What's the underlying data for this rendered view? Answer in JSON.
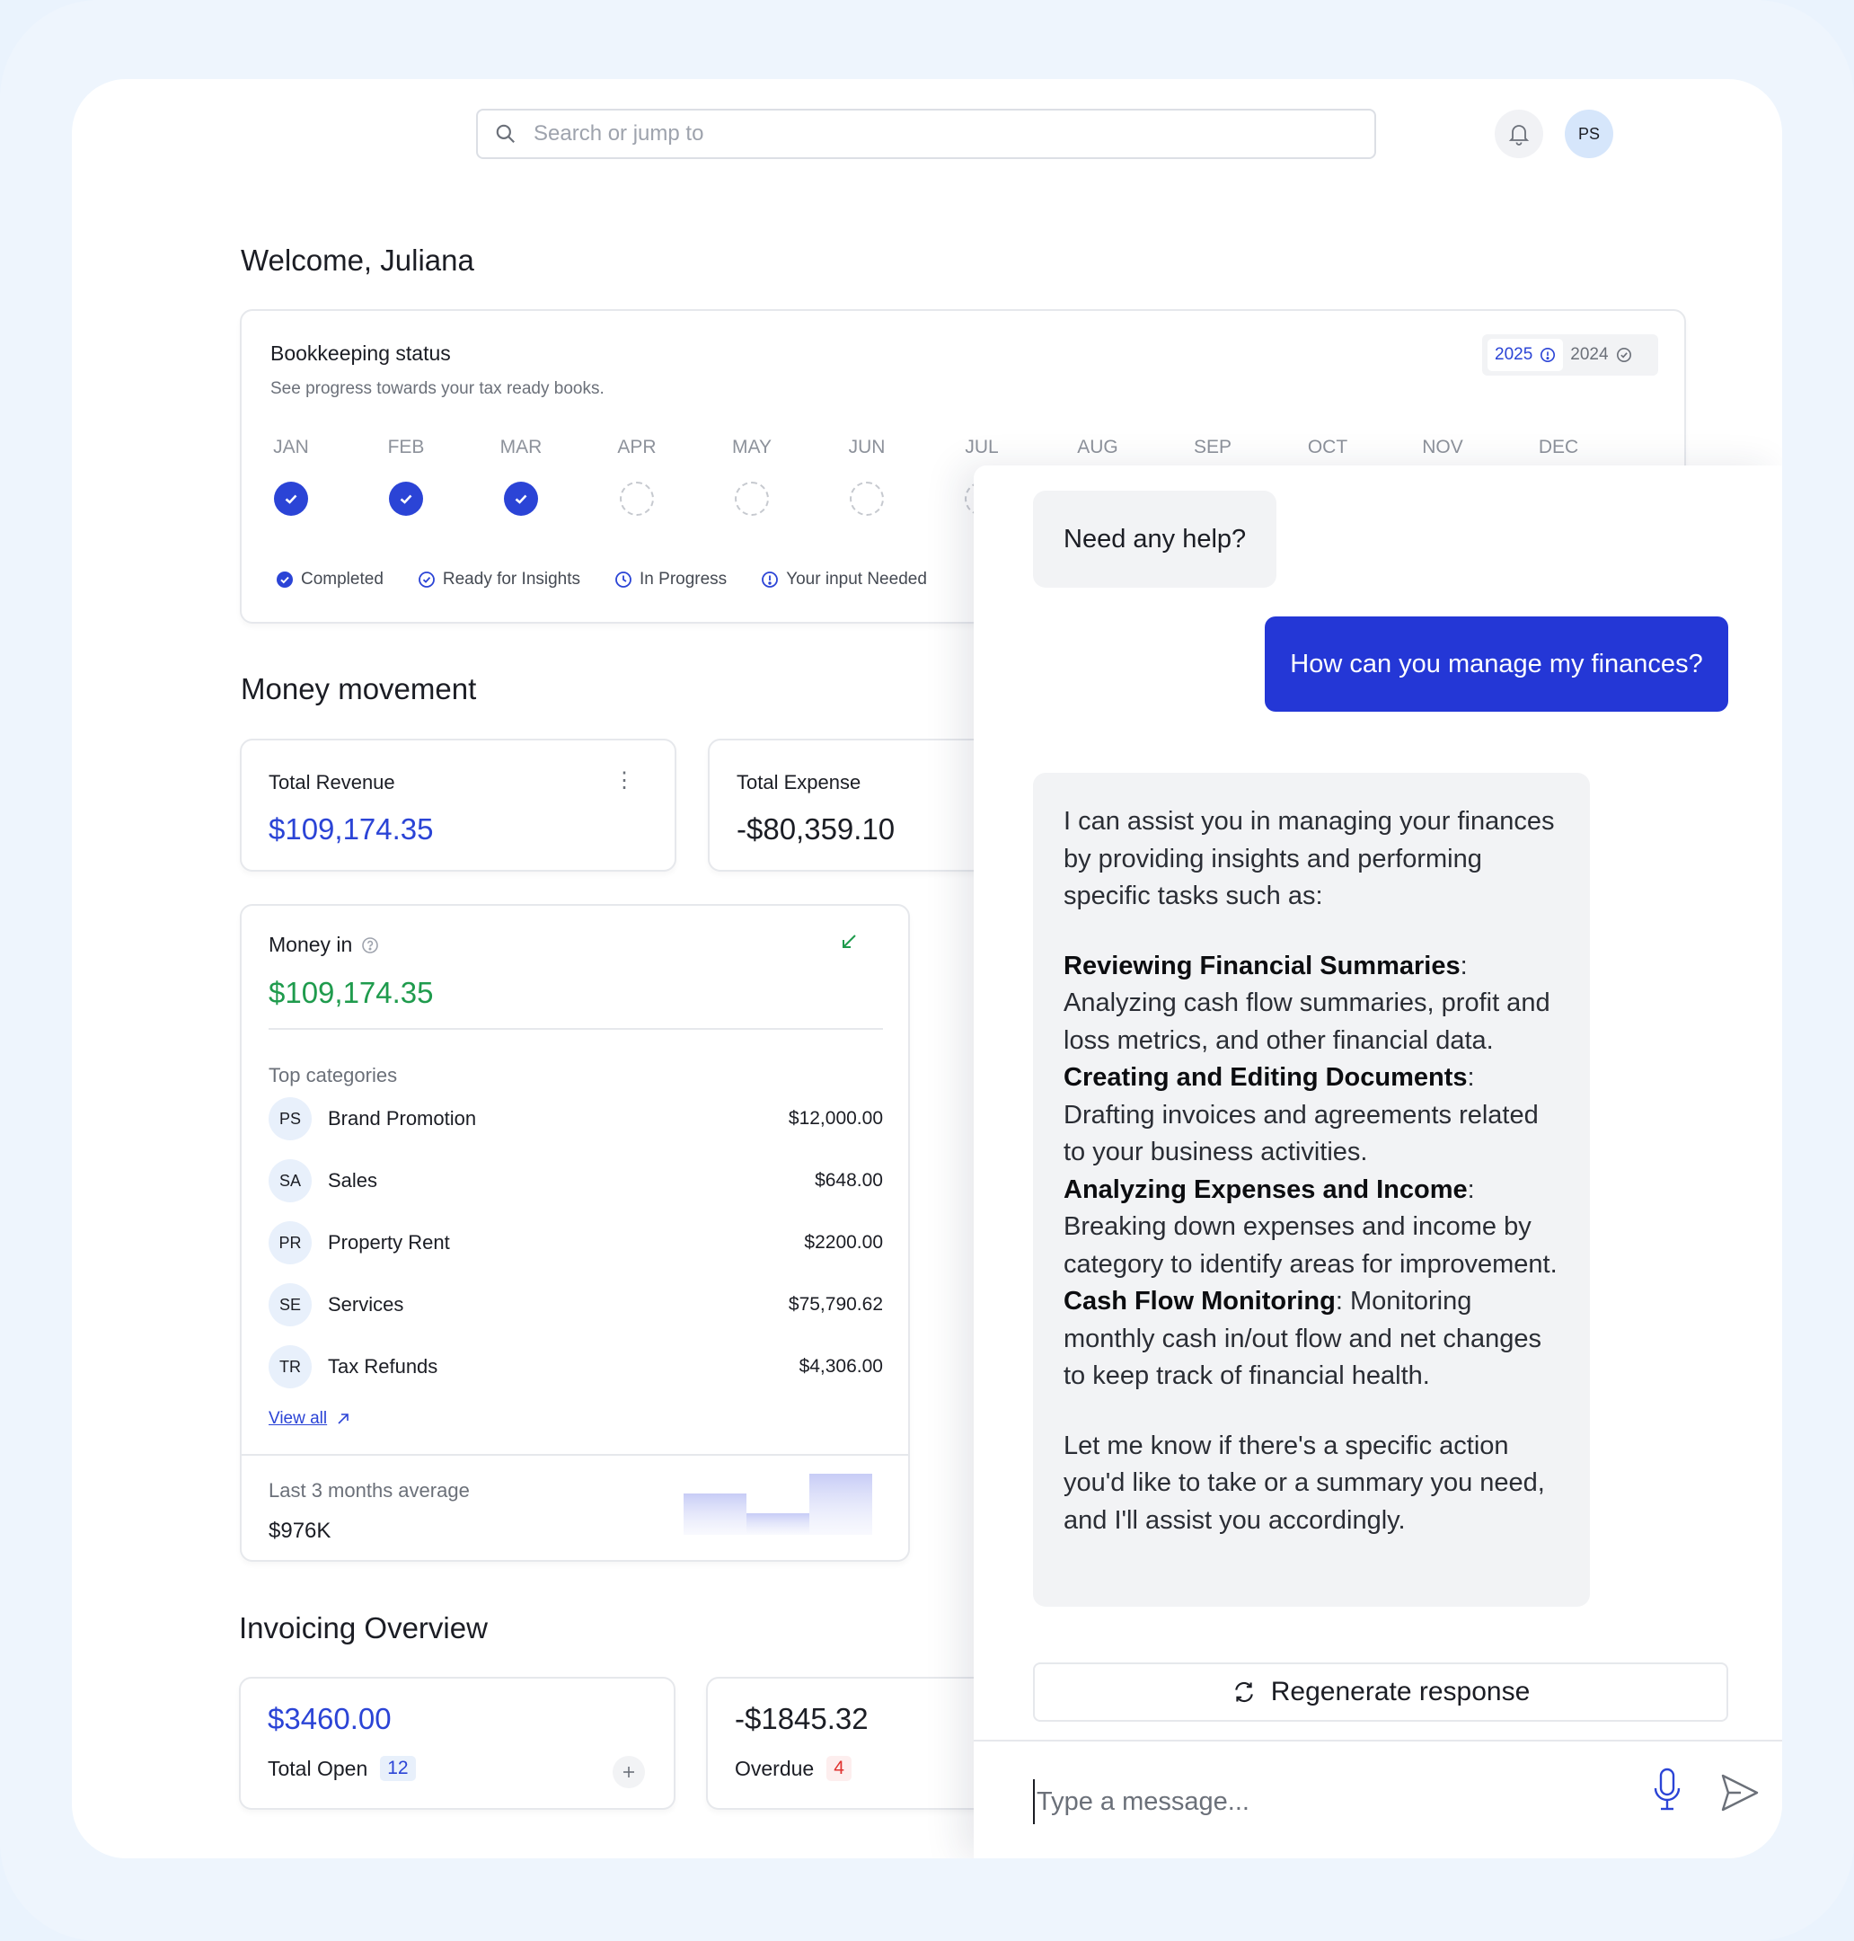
{
  "search": {
    "placeholder": "Search or jump to"
  },
  "user": {
    "initials": "PS"
  },
  "welcome": "Welcome, Juliana",
  "bookkeeping": {
    "title": "Bookkeeping status",
    "subtitle": "See progress towards your tax ready books.",
    "years": [
      "2025",
      "2024"
    ],
    "active_year": "2025",
    "months": [
      "JAN",
      "FEB",
      "MAR",
      "APR",
      "MAY",
      "JUN",
      "JUL",
      "AUG",
      "SEP",
      "OCT",
      "NOV",
      "DEC"
    ],
    "legend": [
      "Completed",
      "Ready for Insights",
      "In Progress",
      "Your input Needed"
    ]
  },
  "money_movement": {
    "title": "Money movement",
    "total_revenue": {
      "label": "Total Revenue",
      "value": "$109,174.35"
    },
    "total_expense": {
      "label": "Total Expense",
      "value": "-$80,359.10"
    },
    "money_in": {
      "title": "Money in",
      "value": "$109,174.35",
      "top_categories_label": "Top categories",
      "categories": [
        {
          "initials": "PS",
          "name": "Brand Promotion",
          "amount": "$12,000.00"
        },
        {
          "initials": "SA",
          "name": "Sales",
          "amount": "$648.00"
        },
        {
          "initials": "PR",
          "name": "Property Rent",
          "amount": "$2200.00"
        },
        {
          "initials": "SE",
          "name": "Services",
          "amount": "$75,790.62"
        },
        {
          "initials": "TR",
          "name": "Tax Refunds",
          "amount": "$4,306.00"
        }
      ],
      "view_all": "View all",
      "avg_label": "Last 3 months average",
      "avg_value": "$976K"
    }
  },
  "invoicing": {
    "title": "Invoicing Overview",
    "open": {
      "value": "$3460.00",
      "label": "Total Open",
      "count": "12"
    },
    "overdue": {
      "value": "-$1845.32",
      "label": "Overdue",
      "count": "4"
    }
  },
  "chat": {
    "greeting": "Need any help?",
    "user_message": "How can you manage my finances?",
    "answer_intro": "I can assist you in managing your finances by providing insights and performing specific tasks such as:",
    "answer_items": [
      {
        "title": "Reviewing Financial Summaries",
        "text": "Analyzing cash flow summaries, profit and loss metrics, and other financial data."
      },
      {
        "title": "Creating and Editing Documents",
        "text": "Drafting invoices and agreements related to your business activities."
      },
      {
        "title": "Analyzing Expenses and Income",
        "text": "Breaking down expenses and income by category to identify areas for improvement."
      },
      {
        "title": "Cash Flow Monitoring",
        "text": "Monitoring monthly cash in/out flow and net changes to keep track of financial health."
      }
    ],
    "answer_outro": "Let me know if there's a specific action you'd like to take or a summary you need, and I'll assist you accordingly.",
    "regenerate": "Regenerate response",
    "input_placeholder": "Type a message..."
  },
  "colors": {
    "accent": "#2b44d6",
    "positive": "#1f9b4d",
    "danger": "#e0322f"
  }
}
